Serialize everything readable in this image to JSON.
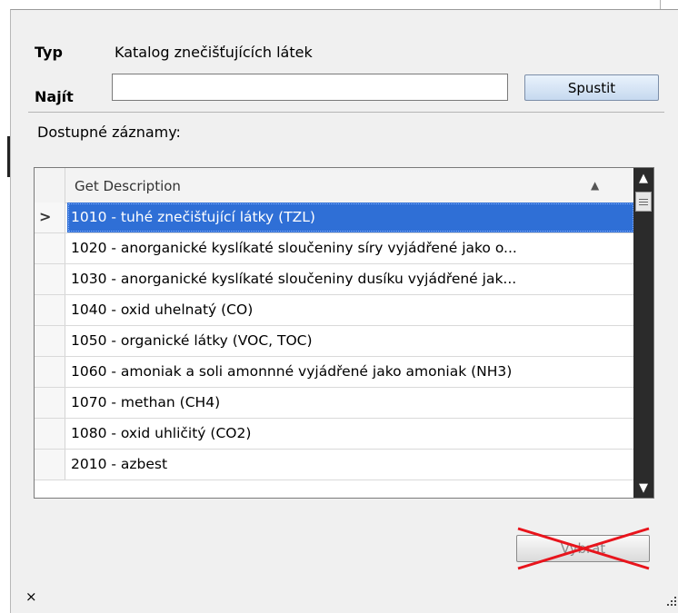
{
  "form": {
    "type_label": "Typ",
    "type_value": "Katalog znečišťujících látek",
    "find_label": "Najít",
    "search_value": "",
    "run_button": "Spustit",
    "available_label": "Dostupné záznamy:"
  },
  "grid": {
    "column_header": "Get Description",
    "sort_indicator": "▲",
    "current_row_marker": ">",
    "rows": [
      "1010 - tuhé znečišťující látky (TZL)",
      "1020 - anorganické kyslíkaté sloučeniny síry vyjádřené jako o...",
      "1030 - anorganické kyslíkaté sloučeniny dusíku vyjádřené jak...",
      "1040 - oxid uhelnatý (CO)",
      "1050 - organické látky (VOC, TOC)",
      "1060 - amoniak a soli amonnné vyjádřené jako amoniak (NH3)",
      "1070 - methan (CH4)",
      "1080 - oxid uhličitý (CO2)",
      "2010 - azbest"
    ],
    "selected_row": 0
  },
  "footer": {
    "choose_button": "Vybrat",
    "close_glyph": "×"
  },
  "colors": {
    "selection": "#2f6fd6",
    "strike": "#e8141c"
  }
}
